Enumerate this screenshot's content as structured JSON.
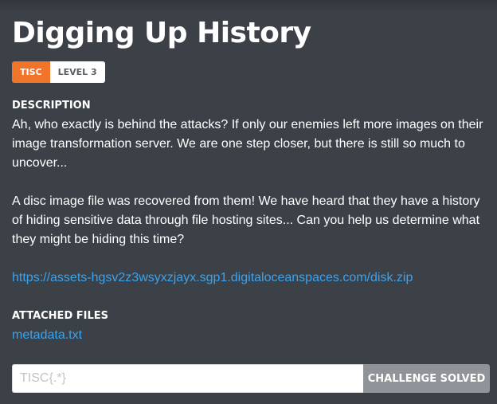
{
  "challenge": {
    "title": "Digging Up History",
    "tags": {
      "category": "TISC",
      "level": "LEVEL 3"
    },
    "description_label": "DESCRIPTION",
    "description_paragraphs": [
      "Ah, who exactly is behind the attacks? If only our enemies left more images on their image transformation server. We are one step closer, but there is still so much to uncover...",
      "A disc image file was recovered from them! We have heard that they have a history of hiding sensitive data through file hosting sites... Can you help us determine what they might be hiding this time?"
    ],
    "download_link": "https://assets-hgsv2z3wsyxzjayx.sgp1.digitaloceanspaces.com/disk.zip",
    "attached_files_label": "ATTACHED FILES",
    "attached_files": [
      "metadata.txt"
    ]
  },
  "flag_form": {
    "placeholder": "TISC{.*}",
    "value": "",
    "button_label": "CHALLENGE SOLVED"
  },
  "colors": {
    "background": "#3c4148",
    "accent": "#f0742a",
    "link": "#3aa3ee",
    "solved_button": "#909397"
  }
}
